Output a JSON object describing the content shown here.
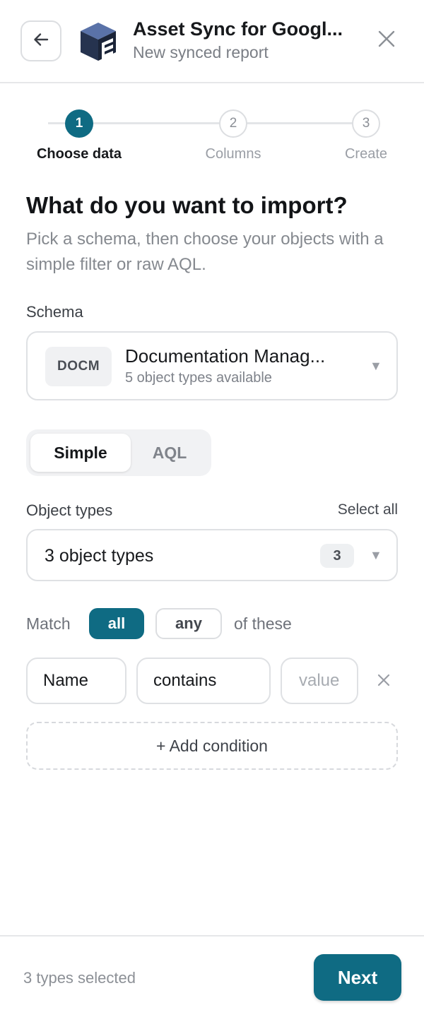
{
  "header": {
    "title": "Asset Sync for Googl...",
    "subtitle": "New synced report",
    "back_icon": "arrow-left-icon",
    "close_icon": "close-icon",
    "logo_icon": "cube-logo-icon"
  },
  "stepper": {
    "steps": [
      {
        "number": "1",
        "label": "Choose data",
        "state": "active"
      },
      {
        "number": "2",
        "label": "Columns",
        "state": "todo"
      },
      {
        "number": "3",
        "label": "Create",
        "state": "todo"
      }
    ]
  },
  "main": {
    "heading": "What do you want to import?",
    "description": "Pick a schema, then choose your objects with a simple filter or raw AQL.",
    "schema": {
      "label": "Schema",
      "badge": "DOCM",
      "name": "Documentation Manag...",
      "subtitle": "5 object types available"
    },
    "mode_tabs": {
      "options": [
        "Simple",
        "AQL"
      ],
      "selected": "Simple"
    },
    "object_types": {
      "label": "Object types",
      "select_all": "Select all",
      "value": "3 object types",
      "count": "3"
    },
    "match": {
      "prefix": "Match",
      "options": [
        "all",
        "any"
      ],
      "selected": "all",
      "suffix": "of these"
    },
    "condition": {
      "field": "Name",
      "operator": "contains",
      "value_placeholder": "value",
      "value": ""
    },
    "add_condition": "+ Add condition"
  },
  "footer": {
    "status": "3 types selected",
    "next_label": "Next"
  },
  "colors": {
    "accent": "#0f6b83",
    "border": "#dfe1e4",
    "muted_text": "#85898f"
  }
}
